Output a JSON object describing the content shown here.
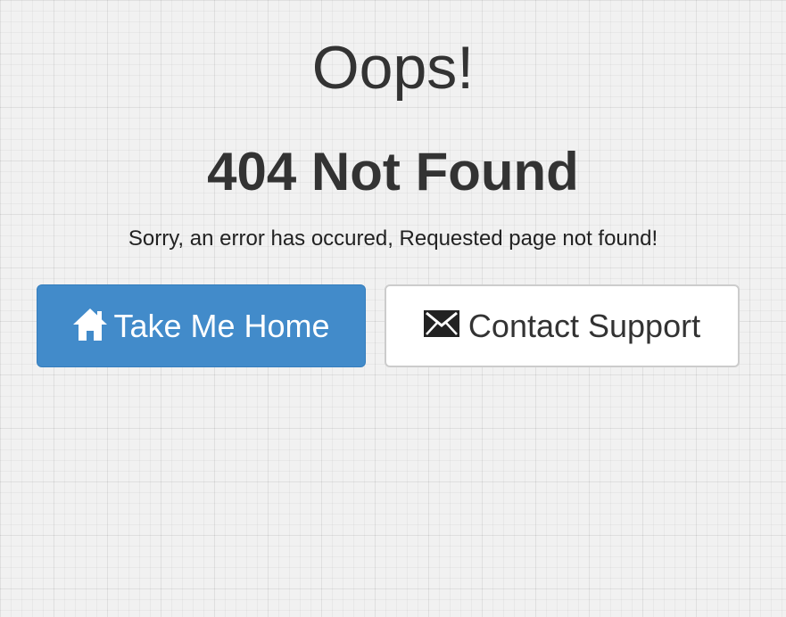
{
  "page": {
    "title": "Oops!",
    "code_message": "404 Not Found",
    "details": "Sorry, an error has occured, Requested page not found!"
  },
  "actions": {
    "home": {
      "label": "Take Me Home",
      "icon": "home-icon",
      "color": "#428bca"
    },
    "support": {
      "label": "Contact Support",
      "icon": "envelope-icon",
      "color": "#ffffff"
    }
  },
  "colors": {
    "text": "#333333",
    "background": "#f1f1f1",
    "primary": "#428bca",
    "border": "#cccccc"
  }
}
